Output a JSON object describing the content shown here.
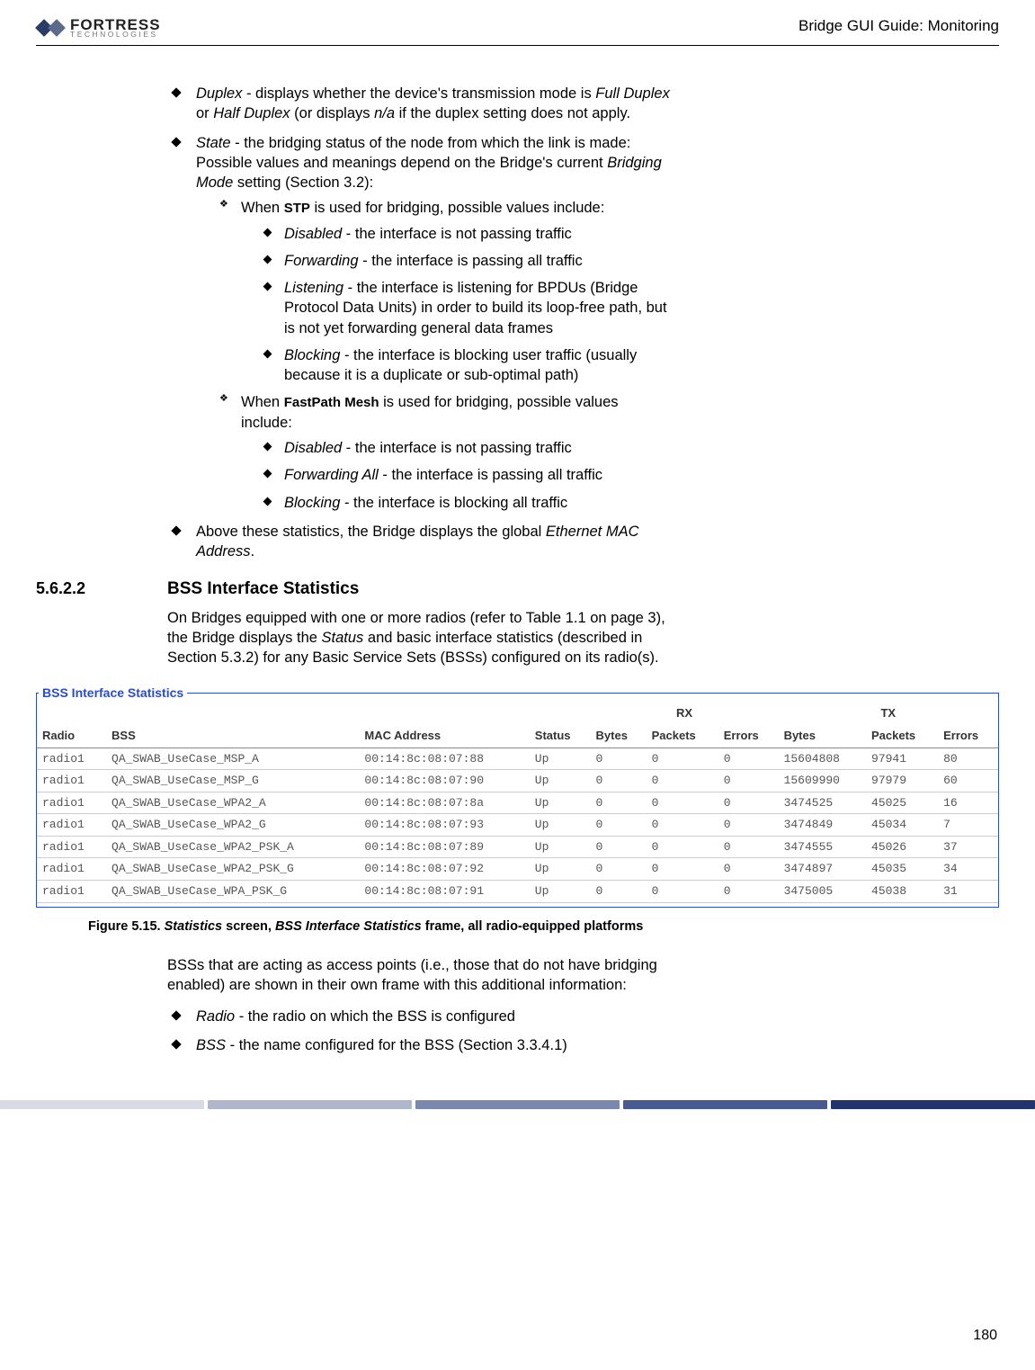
{
  "header": {
    "logo_main": "FORTRESS",
    "logo_sub": "TECHNOLOGIES",
    "guide_title": "Bridge GUI Guide: Monitoring"
  },
  "bullets_top": {
    "duplex_label": "Duplex",
    "duplex_text": " - displays whether the device's transmission mode is ",
    "full_duplex": "Full Duplex",
    "or": " or ",
    "half_duplex": "Half Duplex",
    "duplex_text2": " (or displays ",
    "na": "n/a",
    "duplex_text3": " if the duplex setting does not apply.",
    "state_label": "State",
    "state_text": " - the bridging status of the node from which the link is made: Possible values and meanings depend on the Bridge's current ",
    "bridging_mode": "Bridging Mode",
    "state_text2": " setting (Section 3.2):",
    "when_stp_a": "When ",
    "stp_label": "STP",
    "when_stp_b": " is used for bridging, possible values include:",
    "stp": {
      "disabled_l": "Disabled",
      "disabled_t": " - the interface is not passing traffic",
      "forwarding_l": "Forwarding",
      "forwarding_t": " - the interface is passing all traffic",
      "listening_l": "Listening",
      "listening_t": " - the interface is listening for BPDUs (Bridge Protocol Data Units) in order to build its loop-free path, but is not yet forwarding general data frames",
      "blocking_l": "Blocking",
      "blocking_t": " - the interface is blocking user traffic (usually because it is a duplicate or sub-optimal path)"
    },
    "when_fpm_a": "When ",
    "fpm_label": "FastPath Mesh",
    "when_fpm_b": " is used for bridging, possible values include:",
    "fpm": {
      "disabled_l": "Disabled",
      "disabled_t": " - the interface is not passing traffic",
      "forwarding_l": "Forwarding All",
      "forwarding_t": " - the interface is passing all traffic",
      "blocking_l": "Blocking",
      "blocking_t": " - the interface is blocking all traffic"
    },
    "above_text_a": "Above these statistics, the Bridge displays the global ",
    "above_text_mac": "Ethernet MAC Address",
    "above_text_b": "."
  },
  "section": {
    "num": "5.6.2.2",
    "title": "BSS Interface Statistics",
    "para1_a": "On Bridges equipped with one or more radios (refer to Table 1.1 on page 3), the Bridge displays the ",
    "para1_status": "Status",
    "para1_b": " and basic interface statistics (described in Section 5.3.2) for any Basic Service Sets (BSSs) configured on its radio(s)."
  },
  "bss_table": {
    "legend": "BSS Interface Statistics",
    "group_rx": "RX",
    "group_tx": "TX",
    "headers": [
      "Radio",
      "BSS",
      "MAC Address",
      "Status",
      "Bytes",
      "Packets",
      "Errors",
      "Bytes",
      "Packets",
      "Errors"
    ],
    "rows": [
      [
        "radio1",
        "QA_SWAB_UseCase_MSP_A",
        "00:14:8c:08:07:88",
        "Up",
        "0",
        "0",
        "0",
        "15604808",
        "97941",
        "80"
      ],
      [
        "radio1",
        "QA_SWAB_UseCase_MSP_G",
        "00:14:8c:08:07:90",
        "Up",
        "0",
        "0",
        "0",
        "15609990",
        "97979",
        "60"
      ],
      [
        "radio1",
        "QA_SWAB_UseCase_WPA2_A",
        "00:14:8c:08:07:8a",
        "Up",
        "0",
        "0",
        "0",
        "3474525",
        "45025",
        "16"
      ],
      [
        "radio1",
        "QA_SWAB_UseCase_WPA2_G",
        "00:14:8c:08:07:93",
        "Up",
        "0",
        "0",
        "0",
        "3474849",
        "45034",
        "7"
      ],
      [
        "radio1",
        "QA_SWAB_UseCase_WPA2_PSK_A",
        "00:14:8c:08:07:89",
        "Up",
        "0",
        "0",
        "0",
        "3474555",
        "45026",
        "37"
      ],
      [
        "radio1",
        "QA_SWAB_UseCase_WPA2_PSK_G",
        "00:14:8c:08:07:92",
        "Up",
        "0",
        "0",
        "0",
        "3474897",
        "45035",
        "34"
      ],
      [
        "radio1",
        "QA_SWAB_UseCase_WPA_PSK_G",
        "00:14:8c:08:07:91",
        "Up",
        "0",
        "0",
        "0",
        "3475005",
        "45038",
        "31"
      ]
    ]
  },
  "figure": {
    "label": "Figure 5.15. ",
    "ital1": "Statistics",
    "mid1": " screen, ",
    "ital2": "BSS Interface Statistics",
    "mid2": " frame, all radio-equipped platforms"
  },
  "after_fig": {
    "para": "BSSs that are acting as access points (i.e., those that do not have bridging enabled) are shown in their own frame with this additional information:",
    "radio_l": "Radio",
    "radio_t": " - the radio on which the BSS is configured",
    "bss_l": "BSS",
    "bss_t": " - the name configured for the BSS (Section 3.3.4.1)"
  },
  "page_number": "180"
}
